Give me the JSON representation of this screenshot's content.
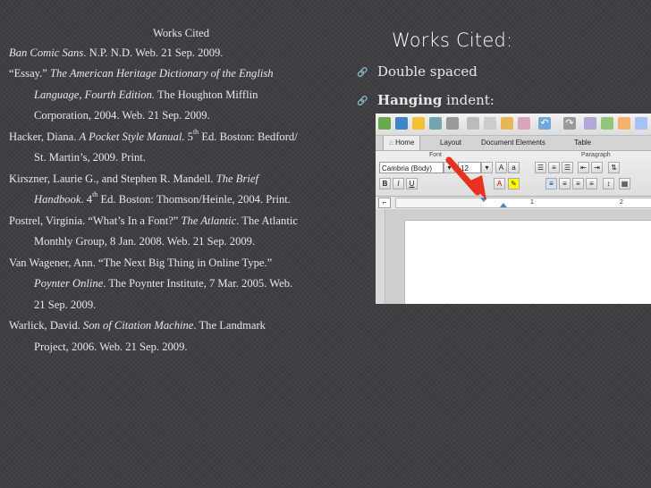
{
  "citations": {
    "heading": "Works Cited",
    "entries": [
      {
        "lines": [
          {
            "parts": [
              {
                "t": "Ban Comic Sans",
                "i": true
              },
              {
                "t": ".  N.P.  N.D. Web.  21 Sep. 2009."
              }
            ]
          }
        ]
      },
      {
        "lines": [
          {
            "parts": [
              {
                "t": "“Essay.” "
              },
              {
                "t": "The American Heritage Dictionary of the English",
                "i": true
              }
            ]
          },
          {
            "parts": [
              {
                "t": "Language, Fourth Edition.",
                "i": true
              },
              {
                "t": "  The Houghton Mifflin"
              }
            ]
          },
          {
            "parts": [
              {
                "t": "Corporation, 2004.  Web.  21 Sep. 2009."
              }
            ]
          }
        ]
      },
      {
        "lines": [
          {
            "parts": [
              {
                "t": "Hacker, Diana.  "
              },
              {
                "t": "A Pocket Style Manual.",
                "i": true
              },
              {
                "t": "  5"
              },
              {
                "t": "th",
                "sup": true
              },
              {
                "t": " Ed.  Boston: Bedford/"
              }
            ]
          },
          {
            "parts": [
              {
                "t": "St. Martin’s, 2009.  Print."
              }
            ]
          }
        ]
      },
      {
        "lines": [
          {
            "parts": [
              {
                "t": "Kirszner, Laurie G., and Stephen R. Mandell.  "
              },
              {
                "t": "The Brief",
                "i": true
              }
            ]
          },
          {
            "parts": [
              {
                "t": "Handbook",
                "i": true
              },
              {
                "t": ".  4"
              },
              {
                "t": "th",
                "sup": true
              },
              {
                "t": " Ed.  Boston:  Thomson/Heinle, 2004.  Print."
              }
            ]
          }
        ]
      },
      {
        "lines": [
          {
            "parts": [
              {
                "t": "Postrel, Virginia.  “What’s In a Font?” "
              },
              {
                "t": "The Atlantic",
                "i": true
              },
              {
                "t": ".  The Atlantic"
              }
            ]
          },
          {
            "parts": [
              {
                "t": "Monthly Group, 8 Jan. 2008.  Web.  21 Sep. 2009."
              }
            ]
          }
        ]
      },
      {
        "lines": [
          {
            "parts": [
              {
                "t": "Van Wagener, Ann.  “The Next Big Thing in Online Type.”"
              }
            ]
          },
          {
            "parts": [
              {
                "t": "Poynter Online",
                "i": true
              },
              {
                "t": ".  The Poynter Institute, 7 Mar. 2005.  Web."
              }
            ]
          },
          {
            "parts": [
              {
                "t": "21 Sep. 2009."
              }
            ]
          }
        ]
      },
      {
        "lines": [
          {
            "parts": [
              {
                "t": "Warlick, David.  "
              },
              {
                "t": "Son of Citation Machine",
                "i": true
              },
              {
                "t": ".  The Landmark"
              }
            ]
          },
          {
            "parts": [
              {
                "t": "Project, 2006.  Web.  21 Sep. 2009."
              }
            ]
          }
        ]
      }
    ]
  },
  "slide": {
    "title": "Works Cited:",
    "bullets": [
      {
        "bold": "",
        "text": "Double spaced"
      },
      {
        "bold": "Hanging",
        "text": " indent:"
      }
    ]
  },
  "word": {
    "tabs": [
      "Home",
      "Layout",
      "Document Elements",
      "Table"
    ],
    "group_font": "Font",
    "group_paragraph": "Paragraph",
    "font_name": "Cambria (Body)",
    "font_size": "12",
    "format_buttons": [
      "B",
      "I",
      "U"
    ],
    "ruler_marks": [
      "1",
      "2"
    ],
    "arrow_color": "#e8321f"
  }
}
